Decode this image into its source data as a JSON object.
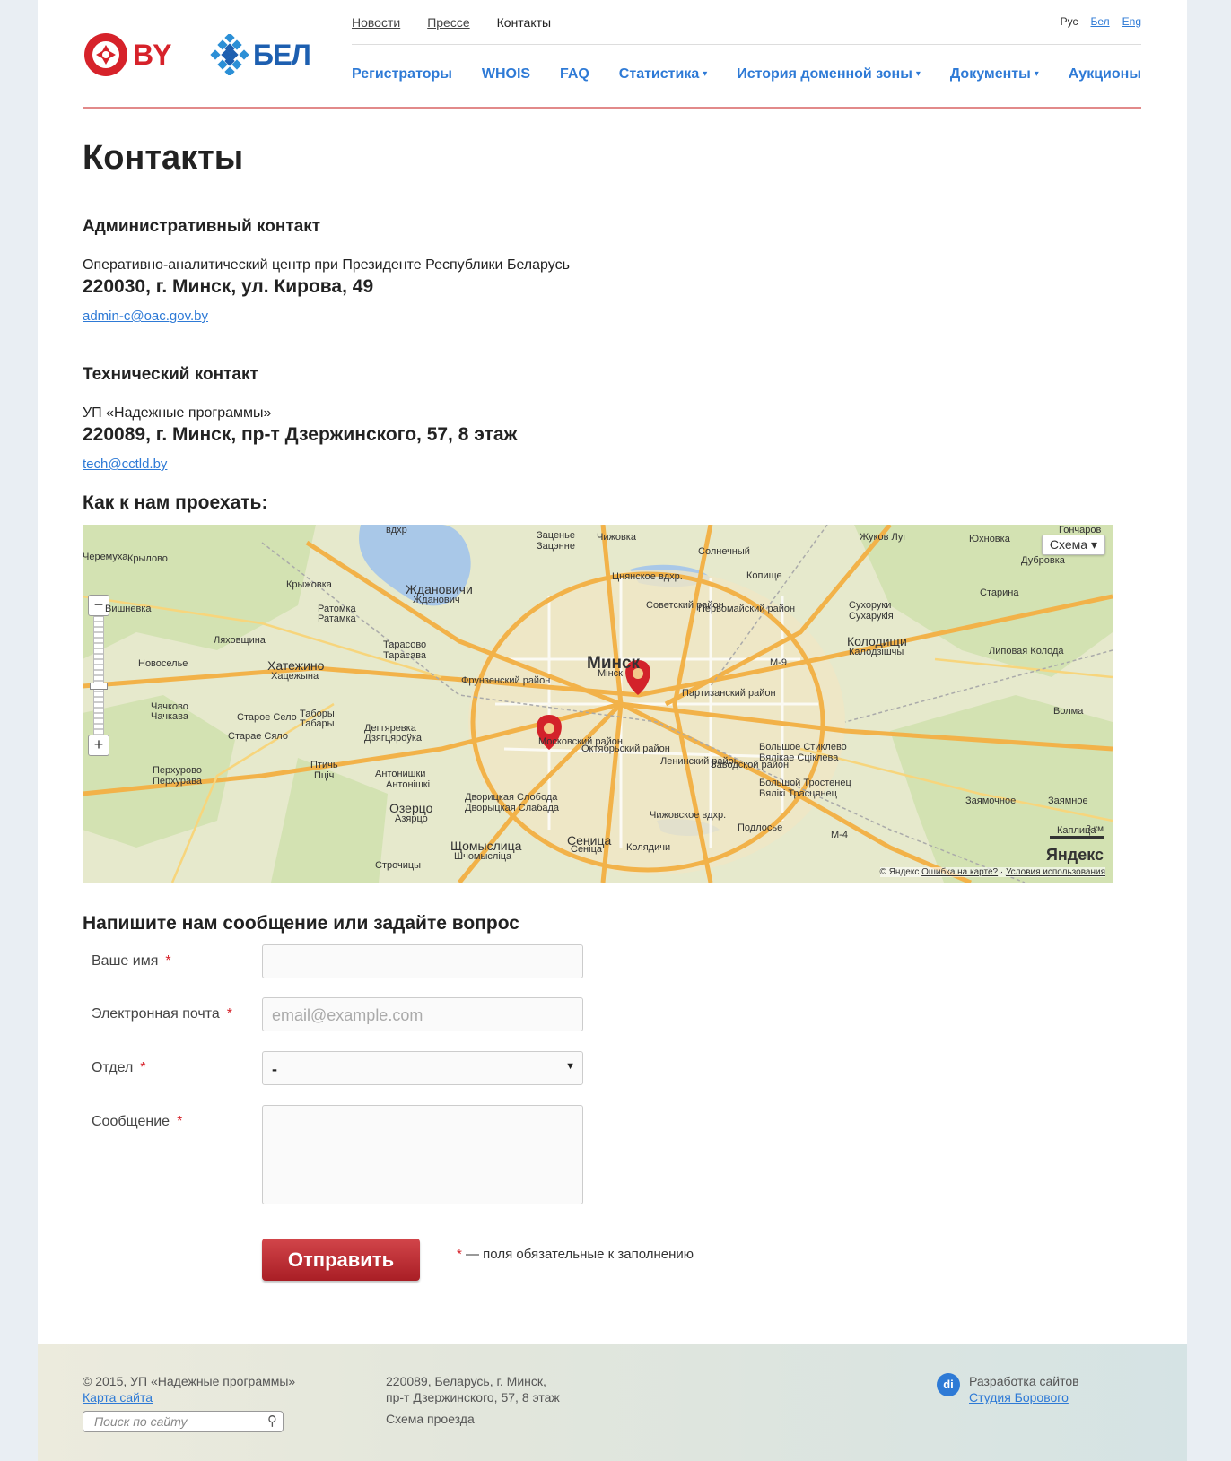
{
  "header": {
    "logo_by_text": "BY",
    "logo_bel_text": "БЕЛ",
    "top_nav": [
      {
        "label": "Новости",
        "link": true
      },
      {
        "label": "Прессе",
        "link": true
      },
      {
        "label": "Контакты",
        "link": false
      }
    ],
    "languages": [
      {
        "label": "Рус",
        "active": true
      },
      {
        "label": "Бел",
        "active": false
      },
      {
        "label": "Eng",
        "active": false
      }
    ],
    "main_nav": [
      {
        "label": "Регистраторы",
        "dropdown": false
      },
      {
        "label": "WHOIS",
        "dropdown": false
      },
      {
        "label": "FAQ",
        "dropdown": false
      },
      {
        "label": "Статистика",
        "dropdown": true
      },
      {
        "label": "История доменной зоны",
        "dropdown": true
      },
      {
        "label": "Документы",
        "dropdown": true
      },
      {
        "label": "Аукционы",
        "dropdown": false
      }
    ]
  },
  "page_title": "Контакты",
  "admin_contact": {
    "heading": "Административный контакт",
    "org": "Оперативно-аналитический центр при Президенте Республики Беларусь",
    "address": "220030, г. Минск, ул. Кирова, 49",
    "email": "admin-c@oac.gov.by"
  },
  "tech_contact": {
    "heading": "Технический контакт",
    "org": "УП «Надежные программы»",
    "address": "220089, г. Минск, пр-т Дзержинского, 57, 8 этаж",
    "email": "tech@cctld.by"
  },
  "map": {
    "heading": "Как к нам проехать:",
    "type_switch": "Схема ▾",
    "zoom_in": "+",
    "zoom_out": "−",
    "labels": [
      "Черемуха",
      "Крылово",
      "Вишневка",
      "Ляховщина",
      "Новоселье",
      "Хатежино",
      "Хацежына",
      "Чачково",
      "Чачкава",
      "Старое Село",
      "Старае Сяло",
      "Таборы",
      "Табары",
      "Перхурово",
      "Перхурава",
      "Птичь",
      "Пціч",
      "Антонишки",
      "Антонішкі",
      "Озерцо",
      "Азярцо",
      "Щомыслица",
      "Шчомысліца",
      "Строчицы",
      "Крыжовка",
      "Ратомка",
      "Ратамка",
      "Ждановичи",
      "Жданович",
      "Тарасово",
      "Тарасава",
      "Дегтяревка",
      "Дзягцяроўка",
      "Фрунзенский район",
      "Московский район",
      "Дворицкая Слобода",
      "Дворыцкая Слабада",
      "Сеница",
      "Сеніца",
      "Колядичи",
      "Октябрьский район",
      "Ленинский район",
      "Заводской район",
      "Партизанский район",
      "Советский район",
      "Первомайский район",
      "Цнянское вдхр.",
      "Чижовское вдхр.",
      "Заценье",
      "Зацэнне",
      "Чижовка",
      "Солнечный",
      "Копище",
      "Жуков Луг",
      "Юхновка",
      "Гончаров",
      "Дубровка",
      "Старина",
      "Сухоруки",
      "Сухарукія",
      "Колодищи",
      "Калодзішчы",
      "Липовая Колода",
      "Волма",
      "Большое Стиклево",
      "Вялікае Сціклева",
      "Большой Тростенец",
      "Вялікі Трасцянец",
      "Заямочное",
      "Заямное",
      "Подлосье",
      "Каплица",
      "вдхр",
      "М-9",
      "М-4",
      "Минск",
      "Мінск"
    ],
    "scale": "3 км",
    "yandex": "Яндекс",
    "copyright": "© Яндекс",
    "error_link": "Ошибка на карте?",
    "terms_link": "Условия использования"
  },
  "form": {
    "heading": "Напишите нам сообщение или задайте вопрос",
    "fields": [
      {
        "label": "Ваше имя",
        "required": "*",
        "placeholder": ""
      },
      {
        "label": "Электронная почта",
        "required": "*",
        "placeholder": "email@example.com"
      },
      {
        "label": "Отдел",
        "required": "*",
        "value": "-"
      },
      {
        "label": "Сообщение",
        "required": "*",
        "placeholder": ""
      }
    ],
    "submit": "Отправить",
    "required_note_star": "*",
    "required_note": " — поля обязательные к заполнению"
  },
  "footer": {
    "copyright": "© 2015, УП «Надежные программы»",
    "sitemap": "Карта сайта",
    "search_placeholder": "Поиск по сайту",
    "address_line1": "220089, Беларусь, г. Минск,",
    "address_line2": "пр-т Дзержинского, 57, 8 этаж",
    "route": "Схема проезда",
    "dev_text": "Разработка сайтов",
    "dev_link": "Студия Борового",
    "dev_logo": "di"
  },
  "colors": {
    "accent": "#2e7ad6",
    "brand_red": "#d6222a",
    "button": "#b92a31"
  }
}
